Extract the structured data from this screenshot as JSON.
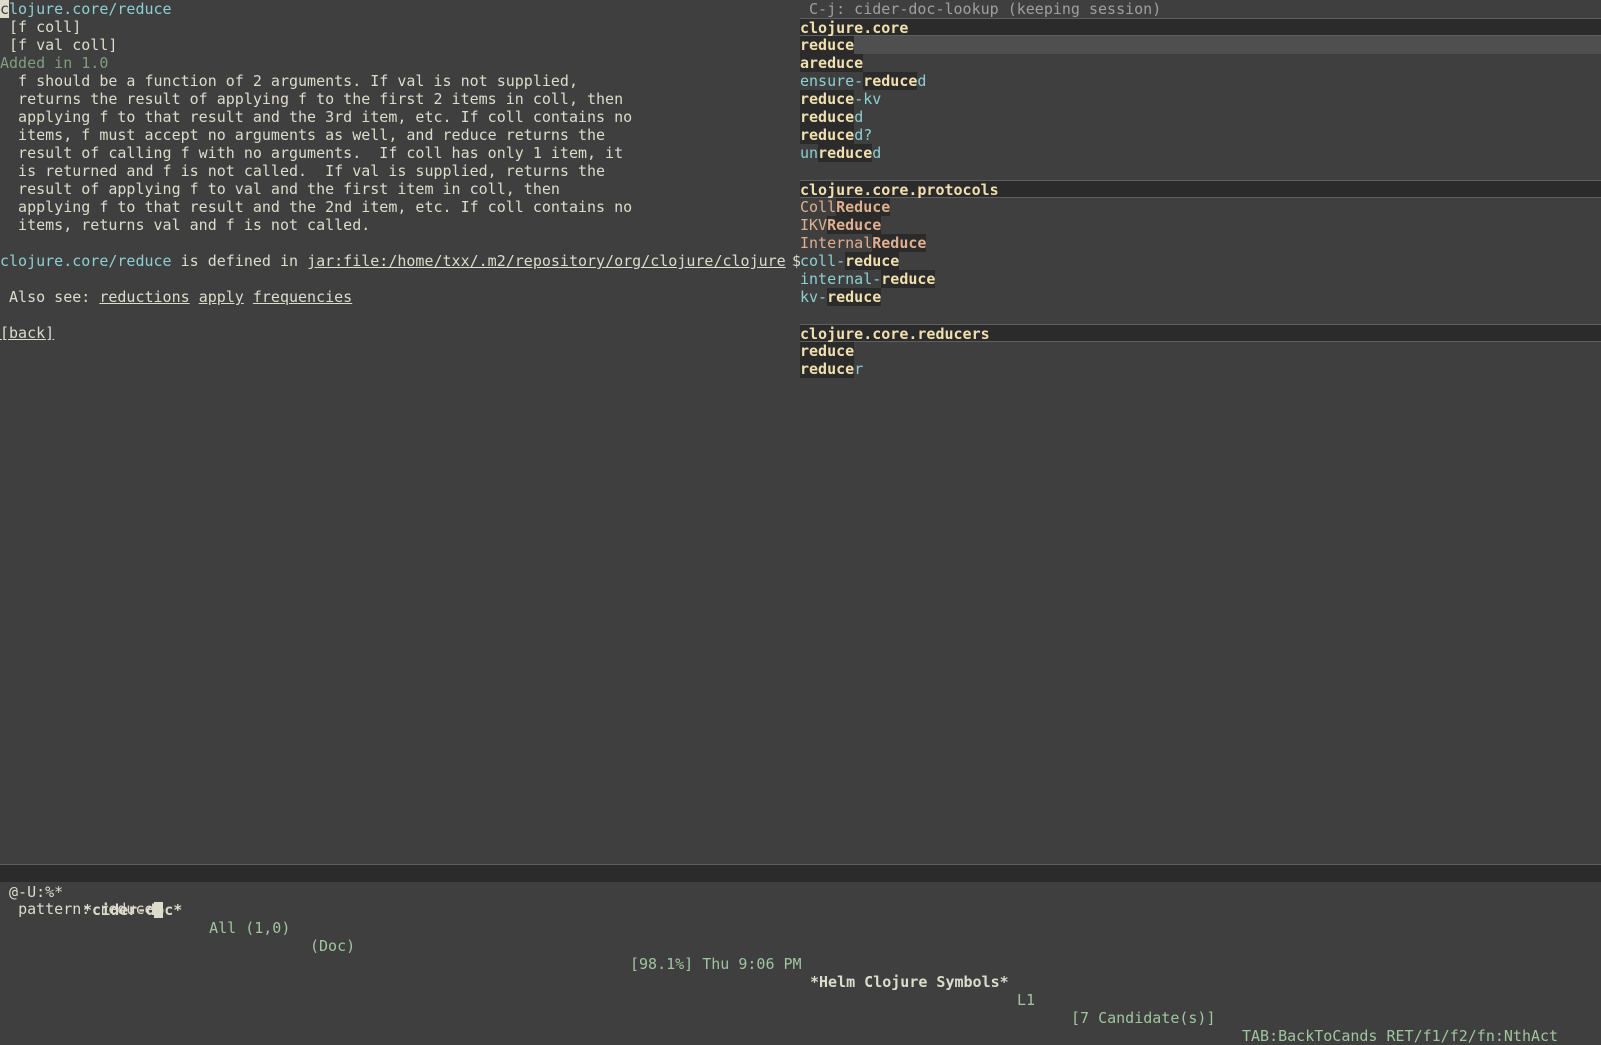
{
  "doc": {
    "symbol": "clojure.core/reduce",
    "arglists": [
      "[f coll]",
      "[f val coll]"
    ],
    "added": "Added in 1.0",
    "docstring": [
      "  f should be a function of 2 arguments. If val is not supplied,",
      "  returns the result of applying f to the first 2 items in coll, then",
      "  applying f to that result and the 3rd item, etc. If coll contains no",
      "  items, f must accept no arguments as well, and reduce returns the",
      "  result of calling f with no arguments.  If coll has only 1 item, it",
      "  is returned and f is not called.  If val is supplied, returns the",
      "  result of applying f to val and the first item in coll, then",
      "  applying f to that result and the 2nd item, etc. If coll contains no",
      "  items, returns val and f is not called."
    ],
    "defined_in_symbol": "clojure.core/reduce",
    "defined_in_text": " is defined in ",
    "defined_in_path": "jar:file:/home/txx/.m2/repository/org/clojure/clojure",
    "truncation_mark": "$",
    "also_see_label": " Also see: ",
    "also_see": [
      "reductions",
      "apply",
      "frequencies"
    ],
    "back_label": "[back]"
  },
  "helm": {
    "header": " C-j: cider-doc-lookup (keeping session)",
    "groups": [
      {
        "title": "clojure.core",
        "candidates": [
          {
            "prefix": "",
            "match": "reduce",
            "suffix": "",
            "selected": true
          },
          {
            "prefix": "",
            "match": "areduce",
            "suffix": "",
            "selected": false
          },
          {
            "prefix": "ensure-",
            "match": "reduce",
            "suffix": "d",
            "selected": false
          },
          {
            "prefix": "",
            "match": "reduce",
            "suffix": "-kv",
            "selected": false
          },
          {
            "prefix": "",
            "match": "reduce",
            "suffix": "d",
            "selected": false
          },
          {
            "prefix": "",
            "match": "reduce",
            "suffix": "d?",
            "selected": false
          },
          {
            "prefix": "un",
            "match": "reduce",
            "suffix": "d",
            "selected": false
          }
        ]
      },
      {
        "title": "clojure.core.protocols",
        "candidates": [
          {
            "prefix": "Coll",
            "match": "Reduce",
            "suffix": "",
            "selected": false,
            "type": true
          },
          {
            "prefix": "IKV",
            "match": "Reduce",
            "suffix": "",
            "selected": false,
            "type": true
          },
          {
            "prefix": "Internal",
            "match": "Reduce",
            "suffix": "",
            "selected": false,
            "type": true
          },
          {
            "prefix": "coll-",
            "match": "reduce",
            "suffix": "",
            "selected": false
          },
          {
            "prefix": "internal-",
            "match": "reduce",
            "suffix": "",
            "selected": false
          },
          {
            "prefix": "kv-",
            "match": "reduce",
            "suffix": "",
            "selected": false
          }
        ]
      },
      {
        "title": "clojure.core.reducers",
        "candidates": [
          {
            "prefix": "",
            "match": "reduce",
            "suffix": "",
            "selected": false
          },
          {
            "prefix": "",
            "match": "reduce",
            "suffix": "r",
            "selected": false
          }
        ]
      }
    ]
  },
  "modeline": {
    "status": " @-U:%*  ",
    "buffer": "*cider-doc*",
    "position": "   All (1,0)  ",
    "mode": "(Doc)",
    "battery_time": "[98.1%] Thu 9:06 PM ",
    "helm_buffer": "*Helm Clojure Symbols*",
    "line": " L1",
    "candidates": "[7 Candidate(s)]",
    "keys": "TAB:BackToCands RET/f1/f2/fn:NthAct"
  },
  "minibuffer": {
    "prompt": "pattern: ",
    "value": "reduce"
  },
  "colors": {
    "background": "#3f3f3f",
    "foreground": "#dcdccc",
    "link": "#8cd0d3",
    "added": "#7f9f7f",
    "match": "#f0dfaf"
  }
}
